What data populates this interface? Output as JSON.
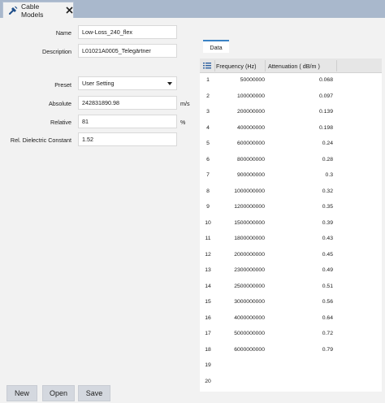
{
  "tab": {
    "title": "Cable Models"
  },
  "form": {
    "name_label": "Name",
    "name_value": "Low-Loss_240_flex",
    "description_label": "Description",
    "description_value": "L01021A0005_Telegärtner",
    "preset_label": "Preset",
    "preset_value": "User Setting",
    "absolute_label": "Absolute",
    "absolute_value": "242831890.98",
    "absolute_unit": "m/s",
    "relative_label": "Relative",
    "relative_value": "81",
    "relative_unit": "%",
    "dielectric_label": "Rel. Dielectric Constant",
    "dielectric_value": "1.52"
  },
  "data_panel": {
    "tab_label": "Data",
    "columns": {
      "frequency": "Frequency (Hz)",
      "attenuation": "Attenuation ( dB/m )"
    },
    "rows": [
      {
        "index": "1",
        "frequency": "50000000",
        "attenuation": "0.068"
      },
      {
        "index": "2",
        "frequency": "100000000",
        "attenuation": "0.097"
      },
      {
        "index": "3",
        "frequency": "200000000",
        "attenuation": "0.139"
      },
      {
        "index": "4",
        "frequency": "400000000",
        "attenuation": "0.198"
      },
      {
        "index": "5",
        "frequency": "600000000",
        "attenuation": "0.24"
      },
      {
        "index": "6",
        "frequency": "800000000",
        "attenuation": "0.28"
      },
      {
        "index": "7",
        "frequency": "900000000",
        "attenuation": "0.3"
      },
      {
        "index": "8",
        "frequency": "1000000000",
        "attenuation": "0.32"
      },
      {
        "index": "9",
        "frequency": "1200000000",
        "attenuation": "0.35"
      },
      {
        "index": "10",
        "frequency": "1500000000",
        "attenuation": "0.39"
      },
      {
        "index": "11",
        "frequency": "1800000000",
        "attenuation": "0.43"
      },
      {
        "index": "12",
        "frequency": "2000000000",
        "attenuation": "0.45"
      },
      {
        "index": "13",
        "frequency": "2300000000",
        "attenuation": "0.49"
      },
      {
        "index": "14",
        "frequency": "2500000000",
        "attenuation": "0.51"
      },
      {
        "index": "15",
        "frequency": "3000000000",
        "attenuation": "0.56"
      },
      {
        "index": "16",
        "frequency": "4000000000",
        "attenuation": "0.64"
      },
      {
        "index": "17",
        "frequency": "5000000000",
        "attenuation": "0.72"
      },
      {
        "index": "18",
        "frequency": "6000000000",
        "attenuation": "0.79"
      },
      {
        "index": "19",
        "frequency": "",
        "attenuation": ""
      },
      {
        "index": "20",
        "frequency": "",
        "attenuation": ""
      }
    ]
  },
  "buttons": {
    "new": "New",
    "open": "Open",
    "save": "Save"
  },
  "icons": {
    "tab": "cable-icon",
    "close": "close-icon",
    "table_menu": "list-icon",
    "dropdown": "chevron-down-icon"
  },
  "colors": {
    "tab_strip": "#a9b8cc",
    "accent": "#3a82c4"
  }
}
